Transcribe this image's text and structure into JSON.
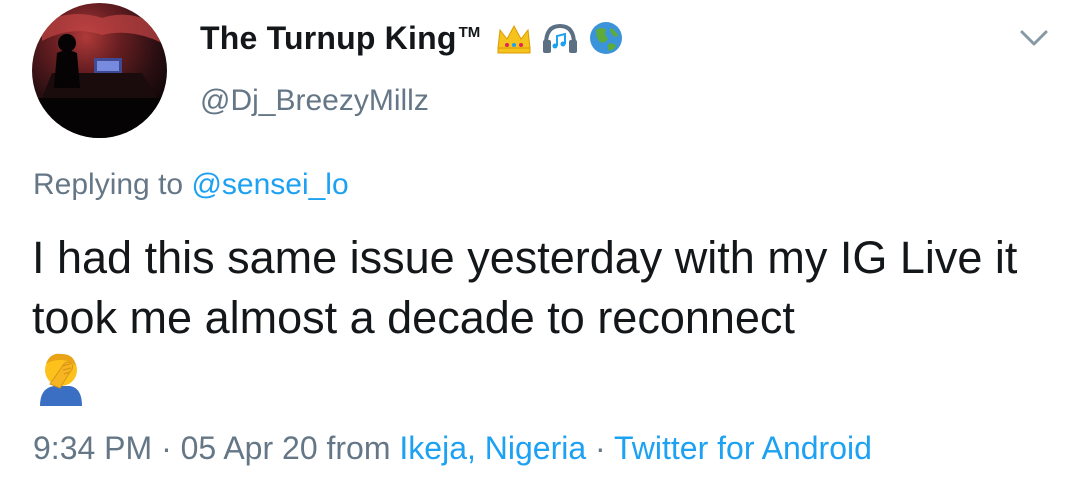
{
  "author": {
    "display_name": "The Turnup King",
    "tm": "TM",
    "handle": "@Dj_BreezyMillz",
    "badges": [
      "crown-icon",
      "headphones-icon",
      "globe-icon"
    ]
  },
  "reply": {
    "prefix": "Replying to ",
    "mention": "@sensei_lo"
  },
  "tweet": {
    "text": "I had this same issue yesterday with my IG Live it took me almost a decade to reconnect",
    "emoji": "facepalm-emoji"
  },
  "meta": {
    "time": "9:34 PM",
    "sep1": " · ",
    "date": "05 Apr 20",
    "from": " from ",
    "location": "Ikeja, Nigeria",
    "sep2": " · ",
    "client": "Twitter for Android"
  },
  "colors": {
    "link": "#1da1f2",
    "secondary": "#657786",
    "text": "#14171a"
  }
}
